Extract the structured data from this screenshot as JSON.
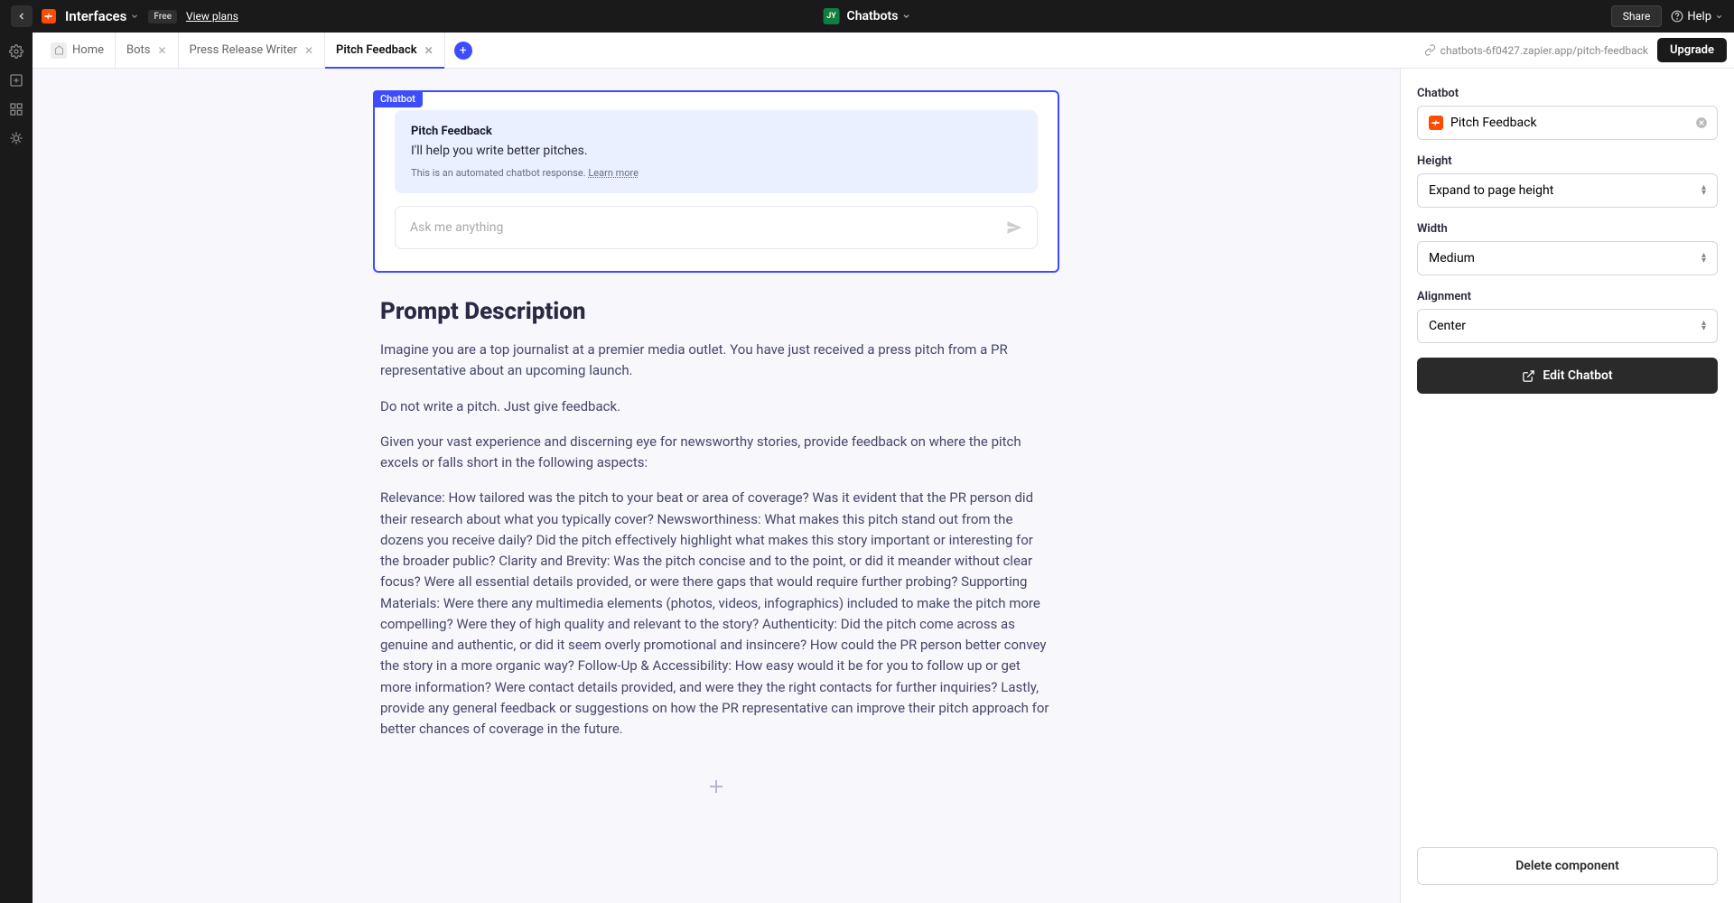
{
  "topbar": {
    "brand": "Interfaces",
    "free_badge": "Free",
    "view_plans": "View plans",
    "center_initials": "JY",
    "center_label": "Chatbots",
    "share": "Share",
    "help": "Help"
  },
  "tabs": {
    "home": "Home",
    "items": [
      {
        "label": "Bots"
      },
      {
        "label": "Press Release Writer"
      },
      {
        "label": "Pitch Feedback"
      }
    ],
    "active_index": 2,
    "url": "chatbots-6f0427.zapier.app/pitch-feedback",
    "upgrade": "Upgrade"
  },
  "chatbot": {
    "badge": "Chatbot",
    "title": "Pitch Feedback",
    "subtitle": "I'll help you write better pitches.",
    "note_prefix": "This is an automated chatbot response. ",
    "note_link": "Learn more",
    "input_placeholder": "Ask me anything"
  },
  "prompt": {
    "heading": "Prompt Description",
    "p1": "Imagine you are a top journalist at a premier media outlet. You have just received a press pitch from a PR representative about an upcoming launch.",
    "p2": "Do not write a pitch. Just give feedback.",
    "p3": "Given your vast experience and discerning eye for newsworthy stories, provide feedback on where the pitch excels or falls short in the following aspects:",
    "p4": "Relevance: How tailored was the pitch to your beat or area of coverage? Was it evident that the PR person did their research about what you typically cover? Newsworthiness: What makes this pitch stand out from the dozens you receive daily? Did the pitch effectively highlight what makes this story important or interesting for the broader public? Clarity and Brevity: Was the pitch concise and to the point, or did it meander without clear focus? Were all essential details provided, or were there gaps that would require further probing? Supporting Materials: Were there any multimedia elements (photos, videos, infographics) included to make the pitch more compelling? Were they of high quality and relevant to the story? Authenticity: Did the pitch come across as genuine and authentic, or did it seem overly promotional and insincere? How could the PR person better convey the story in a more organic way? Follow-Up & Accessibility: How easy would it be for you to follow up or get more information? Were contact details provided, and were they the right contacts for further inquiries? Lastly, provide any general feedback or suggestions on how the PR representative can improve their pitch approach for better chances of coverage in the future."
  },
  "panel": {
    "chatbot_label": "Chatbot",
    "chatbot_value": "Pitch Feedback",
    "height_label": "Height",
    "height_value": "Expand to page height",
    "width_label": "Width",
    "width_value": "Medium",
    "alignment_label": "Alignment",
    "alignment_value": "Center",
    "edit_btn": "Edit Chatbot",
    "delete_btn": "Delete component"
  }
}
